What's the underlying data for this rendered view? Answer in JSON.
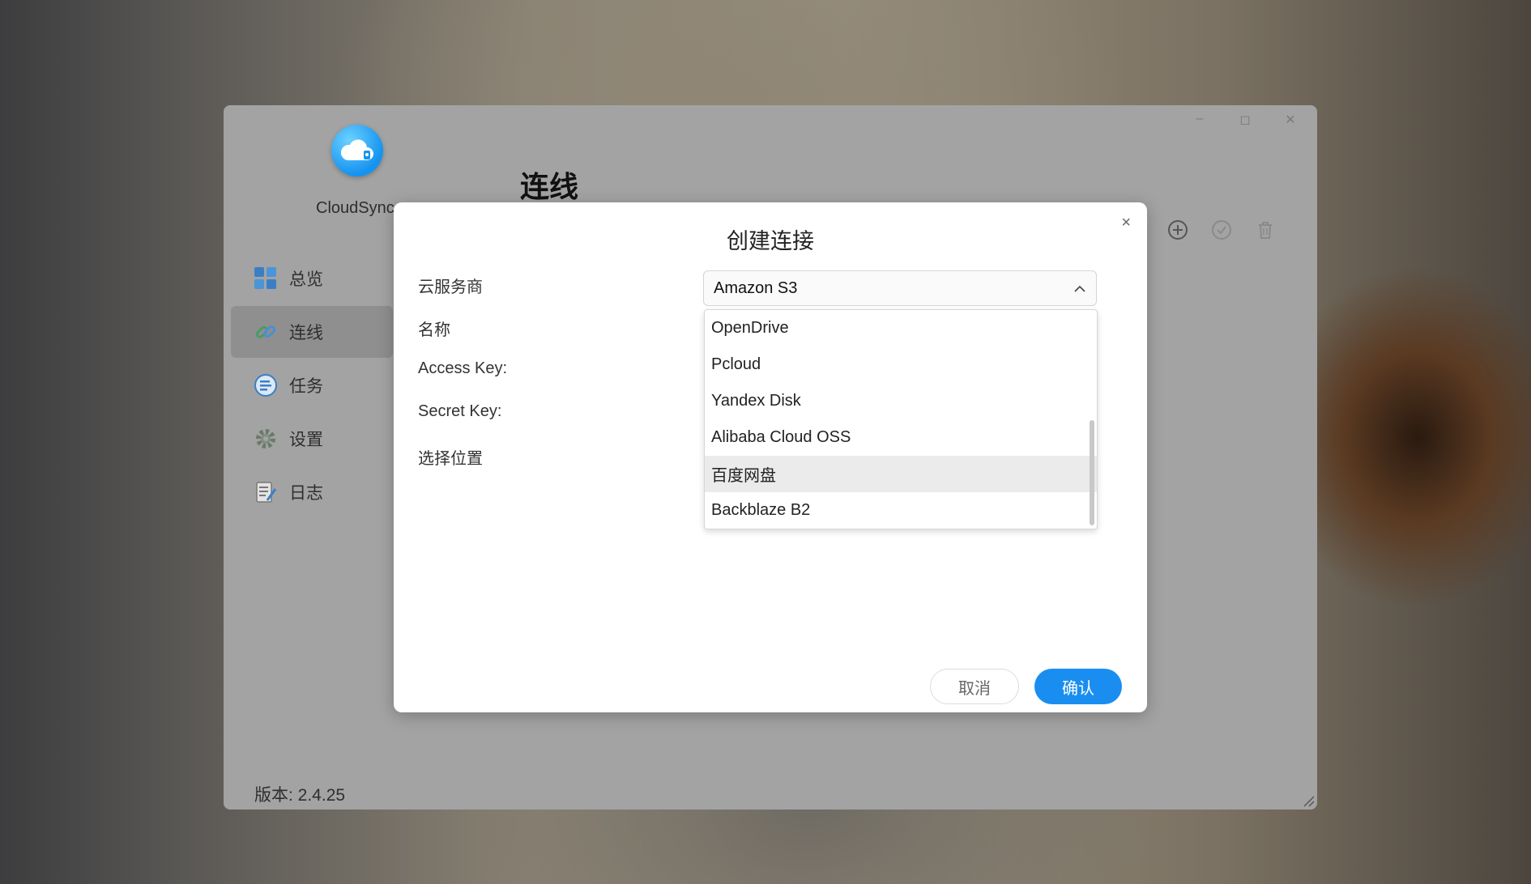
{
  "app": {
    "name": "CloudSync",
    "page_title": "连线",
    "version": "版本: 2.4.25"
  },
  "sidebar": {
    "items": [
      {
        "label": "总览",
        "icon": "grid-icon"
      },
      {
        "label": "连线",
        "icon": "link-icon",
        "active": true
      },
      {
        "label": "任务",
        "icon": "tasks-icon"
      },
      {
        "label": "设置",
        "icon": "gear-icon"
      },
      {
        "label": "日志",
        "icon": "log-icon"
      }
    ]
  },
  "toolbar": {
    "icons": [
      "add-icon",
      "check-icon",
      "trash-icon"
    ]
  },
  "window_controls": {
    "minimize": "–",
    "maximize": "◻",
    "close": "✕"
  },
  "dialog": {
    "title": "创建连接",
    "close": "×",
    "labels": {
      "provider": "云服务商",
      "name": "名称",
      "access_key": "Access Key:",
      "secret_key": "Secret Key:",
      "location": "选择位置"
    },
    "provider_select": {
      "value": "Amazon S3",
      "options": [
        "OpenDrive",
        "Pcloud",
        "Yandex Disk",
        "Alibaba Cloud OSS",
        "百度网盘",
        "Backblaze B2"
      ],
      "highlighted": "百度网盘"
    },
    "cancel": "取消",
    "confirm": "确认"
  },
  "colors": {
    "accent": "#1a8ef0",
    "window_bg": "#a3a3a3",
    "active_nav": "#8f8f8f"
  }
}
